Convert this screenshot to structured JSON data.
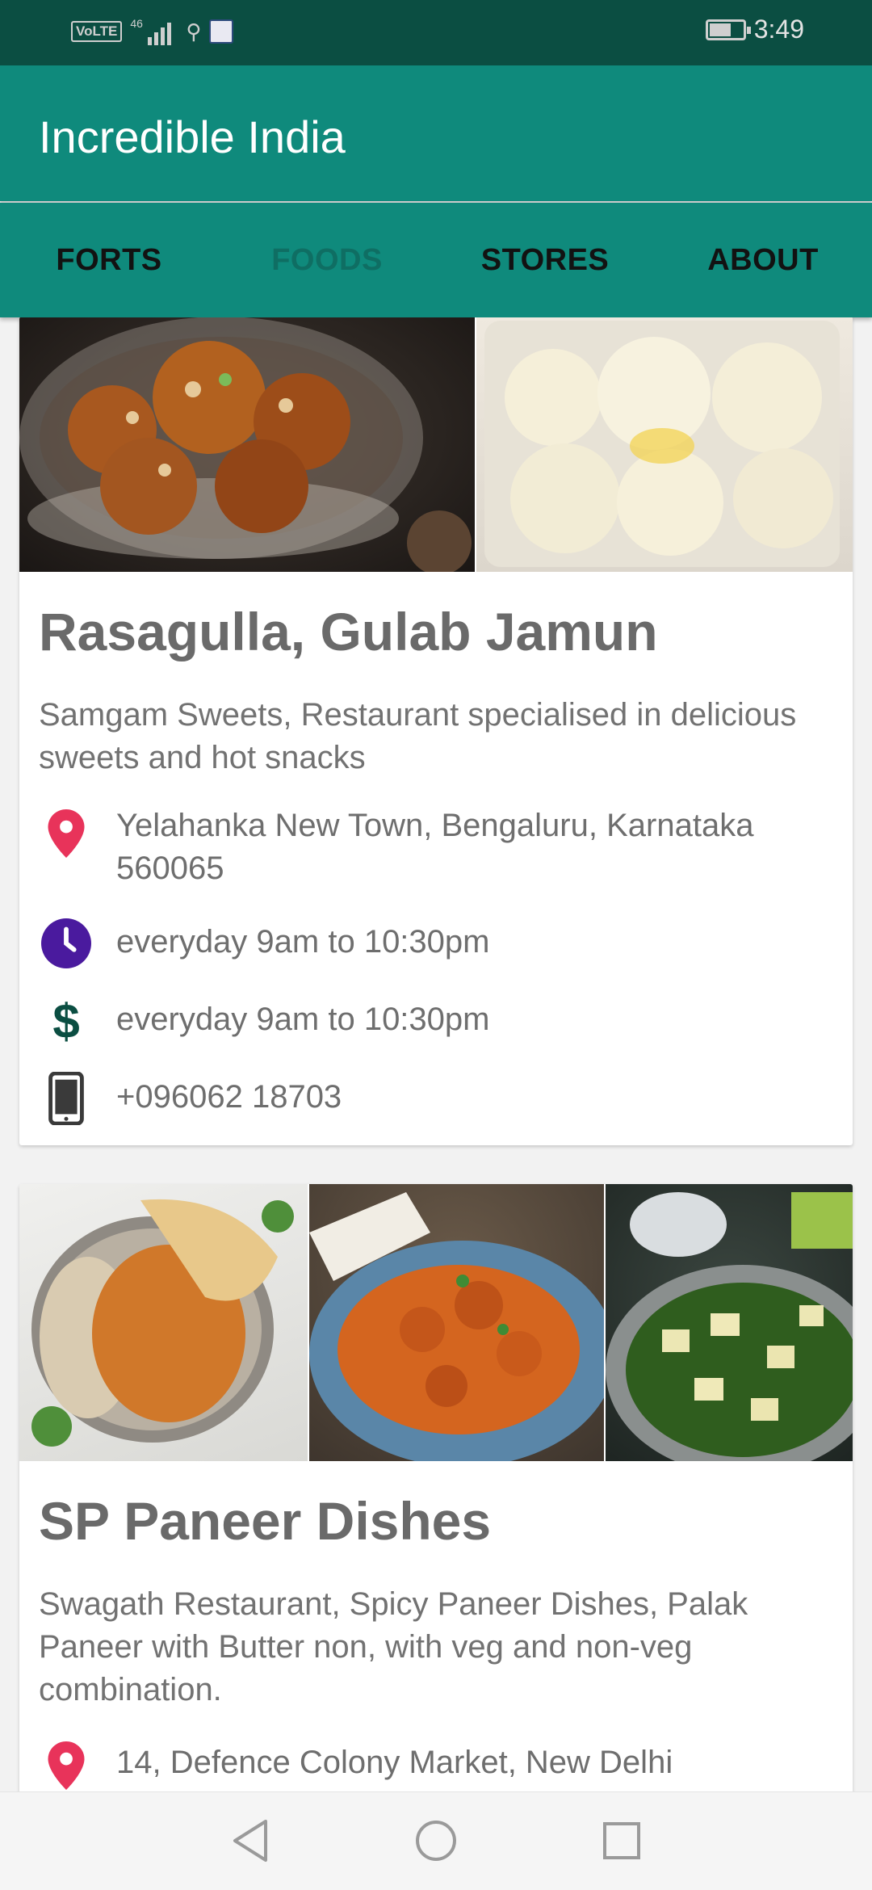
{
  "status_bar": {
    "volte": "VoLTE",
    "network": "46",
    "time": "3:49"
  },
  "app_bar": {
    "title": "Incredible India"
  },
  "tabs": [
    {
      "label": "FORTS",
      "active": false
    },
    {
      "label": "FOODS",
      "active": true
    },
    {
      "label": "STORES",
      "active": false
    },
    {
      "label": "ABOUT",
      "active": false
    }
  ],
  "cards": [
    {
      "title": "Rasagulla, Gulab Jamun",
      "description": "Samgam Sweets, Restaurant specialised in delicious sweets and hot snacks",
      "address": "Yelahanka New Town, Bengaluru, Karnataka 560065",
      "hours": "everyday 9am to 10:30pm",
      "price": "everyday 9am to 10:30pm",
      "phone": "+096062 18703"
    },
    {
      "title": "SP Paneer Dishes",
      "description": "Swagath Restaurant, Spicy Paneer Dishes, Palak Paneer with Butter non, with veg and non-veg combination.",
      "address": "14, Defence Colony Market, New Delhi"
    }
  ],
  "icons": {
    "location": "location-pin-icon",
    "clock": "clock-icon",
    "dollar": "dollar-icon",
    "phone": "phone-icon"
  },
  "colors": {
    "status_bar": "#0b4e42",
    "app_bar": "#0f8a7c",
    "pin": "#e8335a",
    "clock": "#4a1a9e",
    "dollar": "#0b4e42"
  }
}
